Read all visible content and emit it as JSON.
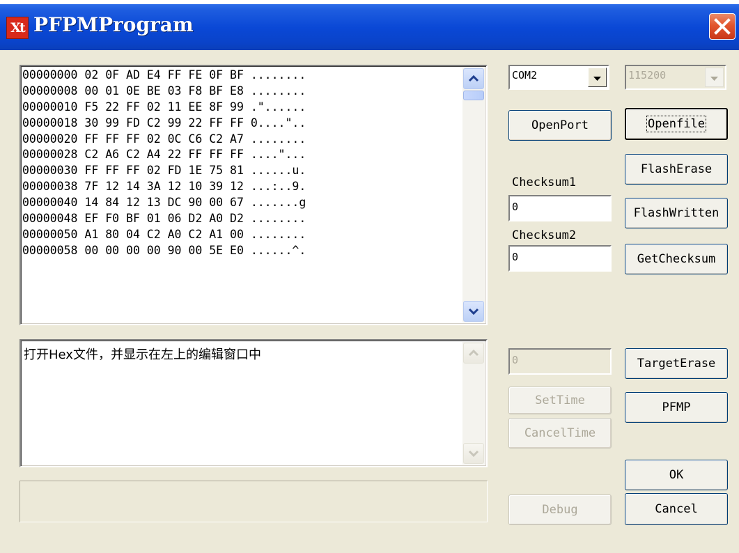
{
  "window": {
    "title": "PFPMProgram",
    "app_icon_text": "Xt",
    "colors": {
      "titlebar": "#0a48d6",
      "client": "#ece9d8",
      "close": "#e2552d"
    }
  },
  "hex_view": {
    "lines": [
      "00000000 02 0F AD E4 FF FE 0F BF ........",
      "00000008 00 01 0E BE 03 F8 BF E8 ........",
      "00000010 F5 22 FF 02 11 EE 8F 99 .\"......",
      "00000018 30 99 FD C2 99 22 FF FF 0....\"..",
      "00000020 FF FF FF 02 0C C6 C2 A7 ........",
      "00000028 C2 A6 C2 A4 22 FF FF FF ....\"...",
      "00000030 FF FF FF 02 FD 1E 75 81 ......u.",
      "00000038 7F 12 14 3A 12 10 39 12 ...:..9.",
      "00000040 14 84 12 13 DC 90 00 67 .......g",
      "00000048 EF F0 BF 01 06 D2 A0 D2 ........",
      "00000050 A1 80 04 C2 A0 C2 A1 00 ........",
      "00000058 00 00 00 00 90 00 5E E0 ......^."
    ]
  },
  "log_view": {
    "text": "打开Hex文件，并显示在左上的编辑窗口中"
  },
  "status_bar": {
    "text": ""
  },
  "port": {
    "selected": "COM2"
  },
  "baud": {
    "selected": "115200"
  },
  "buttons": {
    "open_port": "OpenPort",
    "open_file": "Openfile",
    "flash_erase": "FlashErase",
    "flash_written": "FlashWritten",
    "get_checksum": "GetChecksum",
    "target_erase": "TargetErase",
    "set_time": "SetTime",
    "cancel_time": "CancelTime",
    "pfmp": "PFMP",
    "ok": "OK",
    "debug": "Debug",
    "cancel": "Cancel"
  },
  "checksum1": {
    "label": "Checksum1",
    "value": "0"
  },
  "checksum2": {
    "label": "Checksum2",
    "value": "0"
  },
  "time_field": {
    "value": "0"
  },
  "icons": [
    "app-icon",
    "close-icon",
    "scroll-up-icon",
    "scroll-down-icon",
    "dropdown-arrow-icon"
  ]
}
